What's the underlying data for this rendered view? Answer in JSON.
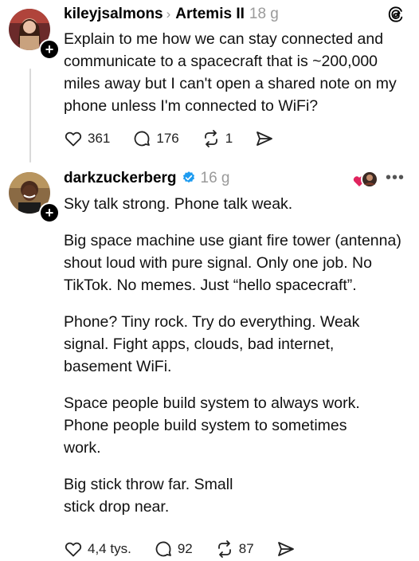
{
  "post1": {
    "username": "kileyjsalmons",
    "topic": "Artemis II",
    "time": "18 g",
    "text": "Explain to me how we can stay connected and communicate to a spacecraft that is ~200,000 miles away but I can't open a shared note on my phone unless I'm connected to WiFi?",
    "likes": "361",
    "replies": "176",
    "reposts": "1"
  },
  "post2": {
    "username": "darkzuckerberg",
    "time": "16 g",
    "paragraphs": [
      "Sky talk strong. Phone talk weak.",
      "Big space machine use giant fire tower (antenna) shout loud with pure signal. Only one job. No TikTok. No memes. Just “hello spacecraft”.",
      "Phone? Tiny rock. Try do everything. Weak signal. Fight apps, clouds, bad internet, basement WiFi.",
      "Space people build system to always work. Phone people build system to sometimes work.",
      "Big stick throw far. Small stick drop near."
    ],
    "likes": "4,4 tys.",
    "replies": "92",
    "reposts": "87"
  },
  "icons": {
    "threads": "threads-logo-icon",
    "like": "heart-icon",
    "reply": "comment-icon",
    "repost": "repost-icon",
    "share": "send-icon",
    "more": "more-icon",
    "verified": "verified-badge-icon"
  },
  "colors": {
    "muted": "#9a9a9a",
    "verified": "#1d9bf0",
    "thread_line": "#d9d9d9"
  }
}
